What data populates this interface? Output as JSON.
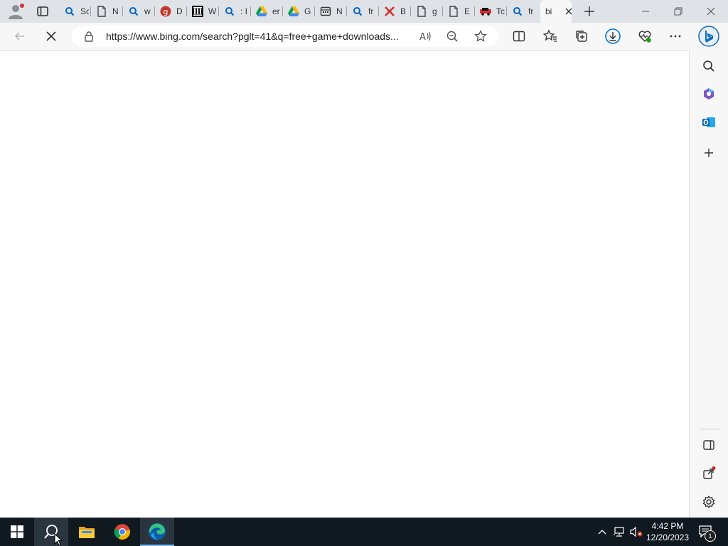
{
  "tabs": [
    {
      "title": "Sc",
      "icon": "search-icon"
    },
    {
      "title": "N",
      "icon": "page-icon"
    },
    {
      "title": "w",
      "icon": "search-icon"
    },
    {
      "title": "D",
      "icon": "g-logo-icon"
    },
    {
      "title": "W",
      "icon": "museum-icon"
    },
    {
      "title": ": I",
      "icon": "search-icon"
    },
    {
      "title": "er",
      "icon": "drive-icon"
    },
    {
      "title": "G",
      "icon": "drive-icon"
    },
    {
      "title": "N",
      "icon": "calendar-icon"
    },
    {
      "title": "fr",
      "icon": "search-icon"
    },
    {
      "title": "B",
      "icon": "x-icon"
    },
    {
      "title": "g",
      "icon": "page-icon"
    },
    {
      "title": "E",
      "icon": "page-icon"
    },
    {
      "title": "Tc",
      "icon": "car-icon"
    },
    {
      "title": "fr",
      "icon": "search-icon"
    },
    {
      "title": "bi",
      "icon": "loading-icon"
    }
  ],
  "address_bar": {
    "url": "https://www.bing.com/search?pglt=41&q=free+game+downloads..."
  },
  "clock": {
    "time": "4:42 PM",
    "date": "12/20/2023"
  },
  "notifications": {
    "count": "1"
  },
  "colors": {
    "tabbar": "#dfe3e8",
    "toolbar": "#f7f7f7",
    "taskbar": "#101820",
    "accent": "#0078d4"
  }
}
